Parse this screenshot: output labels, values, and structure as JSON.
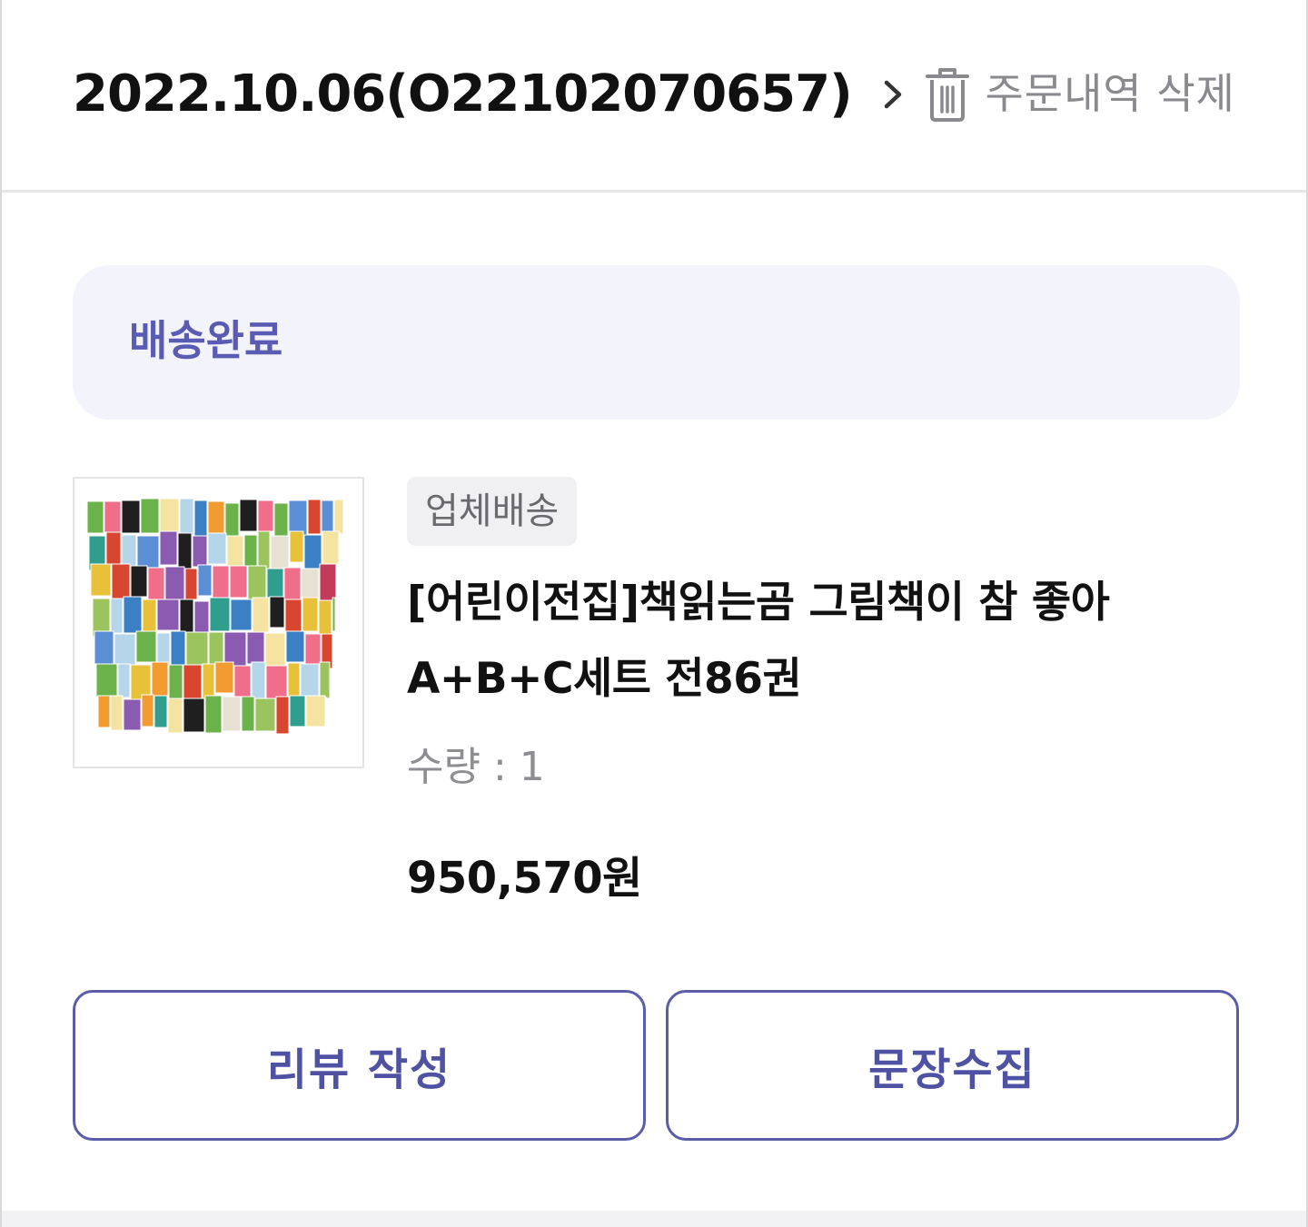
{
  "order": {
    "title": "2022.10.06(O22102070657)",
    "chevron_icon": "chevron-right-icon",
    "delete_label": "주문내역 삭제",
    "delete_icon": "trash-icon"
  },
  "status": {
    "label": "배송완료",
    "color": "#5a5cb4"
  },
  "product": {
    "thumbnail_icon": "book-set-image",
    "badge": "업체배송",
    "name": "[어린이전집]책읽는곰 그림책이 참 좋아 A+B+C세트 전86권",
    "quantity": "수량 : 1",
    "price": "950,570원"
  },
  "actions": {
    "review_label": "리뷰 작성",
    "collect_label": "문장수집",
    "accent_color": "#5b5ea6"
  }
}
